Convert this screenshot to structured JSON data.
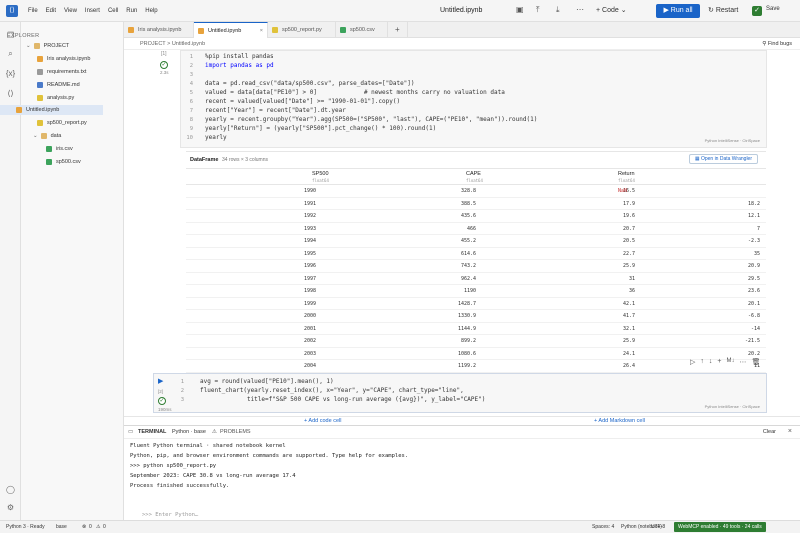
{
  "menu": [
    "File",
    "Edit",
    "View",
    "Insert",
    "Cell",
    "Run",
    "Help"
  ],
  "doc_title": "Untitled.ipynb",
  "toolbar": {
    "code_label": "Code",
    "run_all": "Run all",
    "restart": "Restart",
    "save": "Save"
  },
  "explorer": {
    "title": "EXPLORER",
    "project": "PROJECT",
    "items": [
      {
        "label": "Iris analysis.ipynb",
        "color": "#e8a33c"
      },
      {
        "label": "requirements.txt",
        "color": "#9a9a9a"
      },
      {
        "label": "README.md",
        "color": "#4a7ac9"
      },
      {
        "label": "analysis.py",
        "color": "#e0c23a"
      },
      {
        "label": "Untitled.ipynb",
        "color": "#e8a33c"
      },
      {
        "label": "sp500_report.py",
        "color": "#e0c23a"
      },
      {
        "label": "data",
        "color": "#e0b76a"
      },
      {
        "label": "iris.csv",
        "color": "#3ca35c"
      },
      {
        "label": "sp500.csv",
        "color": "#3ca35c"
      }
    ]
  },
  "tabs": [
    {
      "label": "Iris analysis.ipynb",
      "color": "#e8a33c"
    },
    {
      "label": "Untitled.ipynb",
      "color": "#e8a33c"
    },
    {
      "label": "sp500_report.py",
      "color": "#e0c23a"
    },
    {
      "label": "sp500.csv",
      "color": "#3ca35c"
    }
  ],
  "tab_add": "+",
  "breadcrumb": "PROJECT  >  Untitled.ipynb",
  "find_bugs": "Find bugs",
  "cell1": {
    "number": "[1]",
    "time": "2.3s",
    "caption": "Python IntelliSense · CtrlSpace",
    "lines": [
      "%pip install pandas",
      "import pandas as pd",
      "",
      "data = pd.read_csv(\"data/sp500.csv\", parse_dates=[\"Date\"])",
      "valued = data[data[\"PE10\"] > 0]             # newest months carry no valuation data",
      "recent = valued[valued[\"Date\"] >= \"1990-01-01\"].copy()",
      "recent[\"Year\"] = recent[\"Date\"].dt.year",
      "yearly = recent.groupby(\"Year\").agg(SP500=(\"SP500\", \"last\"), CAPE=(\"PE10\", \"mean\")).round(1)",
      "yearly[\"Return\"] = (yearly[\"SP500\"].pct_change() * 100).round(1)",
      "yearly"
    ]
  },
  "dataframe": {
    "title": "DataFrame",
    "subtitle": "34 rows × 3 columns",
    "wrangler": "Open in Data Wrangler",
    "columns": [
      {
        "name": "SP500",
        "type": "float64"
      },
      {
        "name": "CAPE",
        "type": "float64"
      },
      {
        "name": "Return",
        "type": "float64"
      }
    ],
    "rows": [
      [
        "1990",
        "328.8",
        "16.5",
        "NaN"
      ],
      [
        "1991",
        "388.5",
        "17.9",
        "18.2"
      ],
      [
        "1992",
        "435.6",
        "19.6",
        "12.1"
      ],
      [
        "1993",
        "466",
        "20.7",
        "7"
      ],
      [
        "1994",
        "455.2",
        "20.5",
        "-2.3"
      ],
      [
        "1995",
        "614.6",
        "22.7",
        "35"
      ],
      [
        "1996",
        "743.2",
        "25.9",
        "20.9"
      ],
      [
        "1997",
        "962.4",
        "31",
        "29.5"
      ],
      [
        "1998",
        "1190",
        "36",
        "23.6"
      ],
      [
        "1999",
        "1428.7",
        "42.1",
        "20.1"
      ],
      [
        "2000",
        "1330.9",
        "41.7",
        "-6.8"
      ],
      [
        "2001",
        "1144.9",
        "32.1",
        "-14"
      ],
      [
        "2002",
        "899.2",
        "25.9",
        "-21.5"
      ],
      [
        "2003",
        "1080.6",
        "24.1",
        "20.2"
      ],
      [
        "2004",
        "1199.2",
        "26.4",
        "11"
      ]
    ]
  },
  "cell2": {
    "number": "[2]",
    "time": "190ms",
    "caption": "Python IntelliSense · CtrlSpace",
    "lines": [
      "avg = round(valued[\"PE10\"].mean(), 1)",
      "fluent_chart(yearly.reset_index(), x=\"Year\", y=\"CAPE\", chart_type=\"line\",",
      "             title=f\"S&P 500 CAPE vs long-run average ({avg})\", y_label=\"CAPE\")"
    ]
  },
  "add_code": "+ Add code cell",
  "add_markdown": "+ Add Markdown cell",
  "terminal": {
    "tab_terminal": "TERMINAL",
    "tab_python": "Python · base",
    "tab_problems": "PROBLEMS",
    "clear": "Clear",
    "lines": [
      "Fluent Python terminal · shared notebook kernel",
      "Python, pip, and browser environment commands are supported. Type help for examples.",
      ">>> python sp500_report.py",
      "September 2023: CAPE 30.8 vs long-run average 17.4",
      "Process finished successfully."
    ],
    "input_placeholder": ">>> Enter Python…"
  },
  "status": {
    "kernel": "Python 3 · Ready",
    "env": "base",
    "errors": "0",
    "warnings": "0",
    "spaces": "Spaces: 4",
    "language": "Python (notebook)",
    "encoding": "UTF-8",
    "mcp": "WebMCP enabled · 49 tools · 24 calls"
  }
}
